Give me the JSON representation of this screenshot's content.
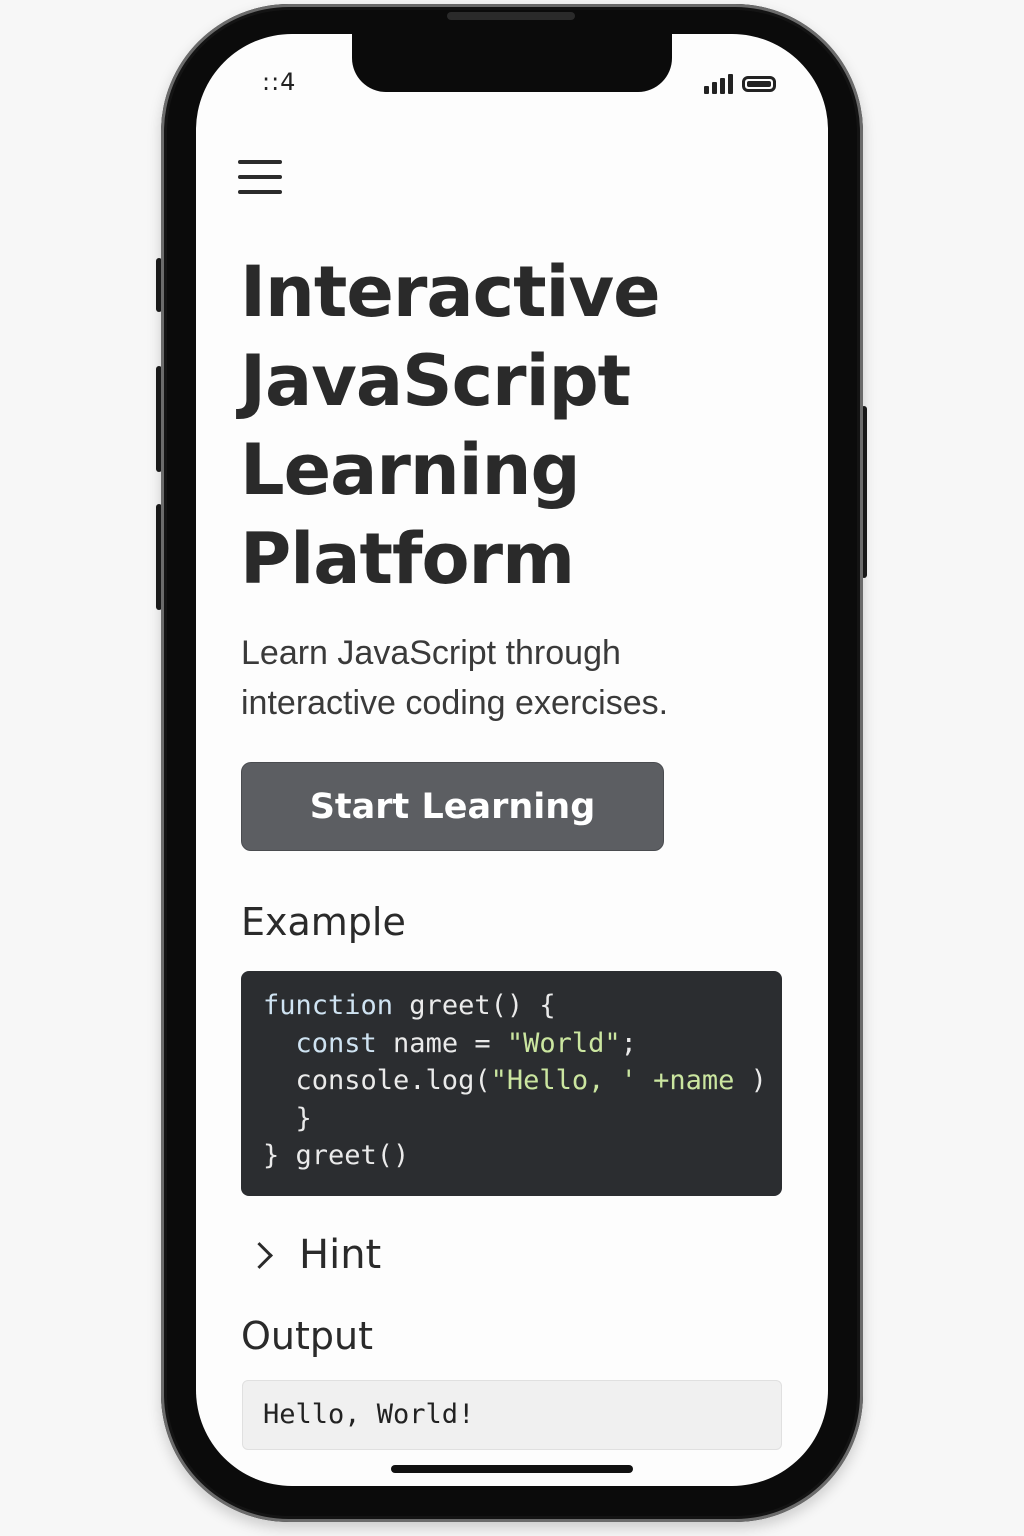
{
  "status_bar": {
    "time": "::4"
  },
  "header": {
    "menu_icon": "hamburger-menu-icon"
  },
  "hero": {
    "title": "Interactive JavaScript Learning Platform",
    "subtitle": "Learn JavaScript through interactive coding exercises.",
    "cta_label": "Start Learning"
  },
  "example": {
    "heading": "Example",
    "code_lines": [
      [
        "function",
        " greet() {"
      ],
      [
        "  const",
        " name = ",
        "\"World\"",
        ";"
      ],
      [
        "  console.log(",
        "\"Hello, ' +name",
        " )"
      ],
      [
        "  }"
      ],
      [
        "} greet()"
      ]
    ]
  },
  "hint": {
    "label": "Hint",
    "icon": "chevron-right-icon"
  },
  "output": {
    "heading": "Output",
    "value": "Hello, World!"
  },
  "colors": {
    "cta_background": "#5c5e62",
    "code_background": "#2b2d30",
    "code_string": "#cbe6a0",
    "code_keyword": "#cfe3f2"
  }
}
